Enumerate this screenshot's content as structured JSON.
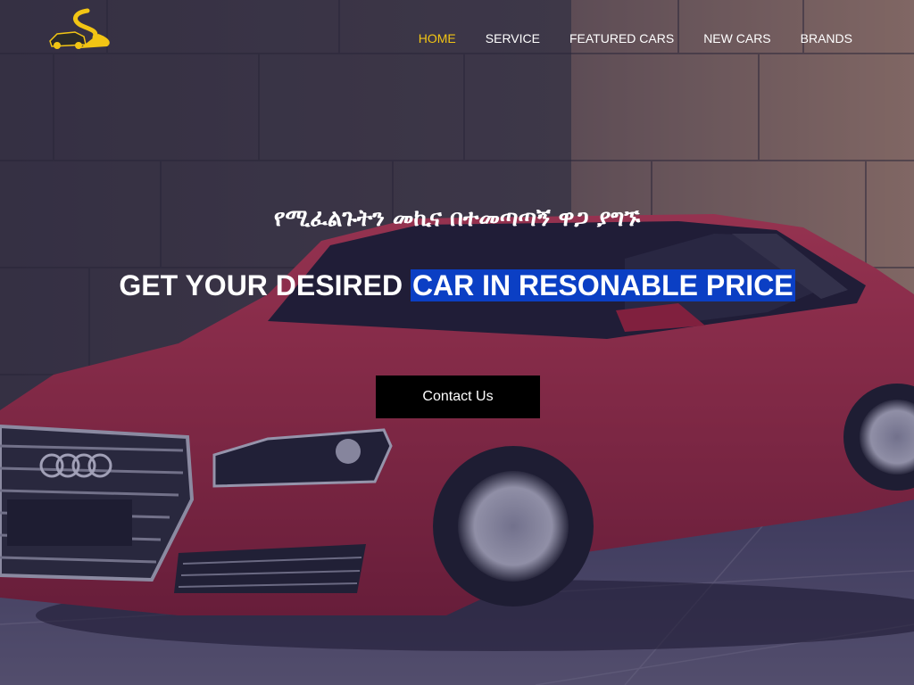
{
  "nav": {
    "items": [
      {
        "label": "HOME",
        "active": true
      },
      {
        "label": "SERVICE",
        "active": false
      },
      {
        "label": "FEATURED CARS",
        "active": false
      },
      {
        "label": "NEW CARS",
        "active": false
      },
      {
        "label": "BRANDS",
        "active": false
      }
    ]
  },
  "hero": {
    "tagline_amharic": "የሚፈልጉትን መኪና በተመጣጣኝ ዋጋ ያግኙ",
    "headline_plain": "GET YOUR DESIRED",
    "headline_highlight": "CAR IN RESONABLE PRICE",
    "cta_label": "Contact Us"
  },
  "colors": {
    "accent": "#f2c514",
    "highlight": "#0b3fc4",
    "car_red": "#c7283a"
  },
  "icons": {
    "logo": "car-swoosh-logo"
  }
}
